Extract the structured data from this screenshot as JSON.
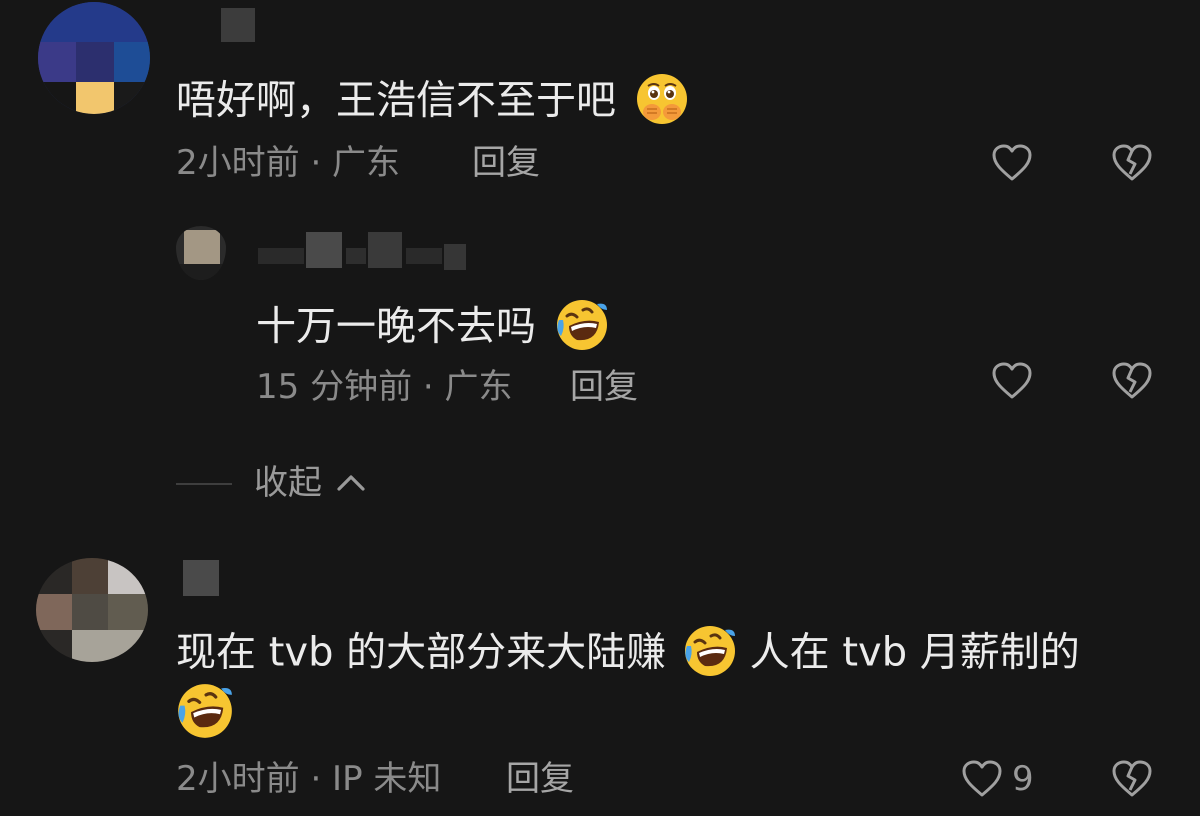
{
  "comments": [
    {
      "text": "唔好啊，王浩信不至于吧",
      "emoji": "hands-over-mouth-emoji",
      "meta": "2小时前 · 广东",
      "reply_label": "回复",
      "like_count": ""
    },
    {
      "text": "十万一晚不去吗",
      "emoji": "rofl-emoji",
      "meta": "15 分钟前 · 广东",
      "reply_label": "回复",
      "like_count": ""
    },
    {
      "text_part1": "现在 tvb 的大部分来大陆赚",
      "text_part2": "人在 tvb 月薪制的",
      "emoji": "rofl-emoji",
      "meta": "2小时前 · IP 未知",
      "reply_label": "回复",
      "like_count": "9"
    }
  ],
  "collapse": {
    "label": "收起",
    "icon": "chevron-up-icon"
  },
  "icons": {
    "like": "heart-outline-icon",
    "dislike": "broken-heart-icon"
  },
  "colors": {
    "background": "#161616",
    "text": "#ebebeb",
    "meta": "#8a8a8a",
    "emoji_yellow": "#f7c531"
  }
}
